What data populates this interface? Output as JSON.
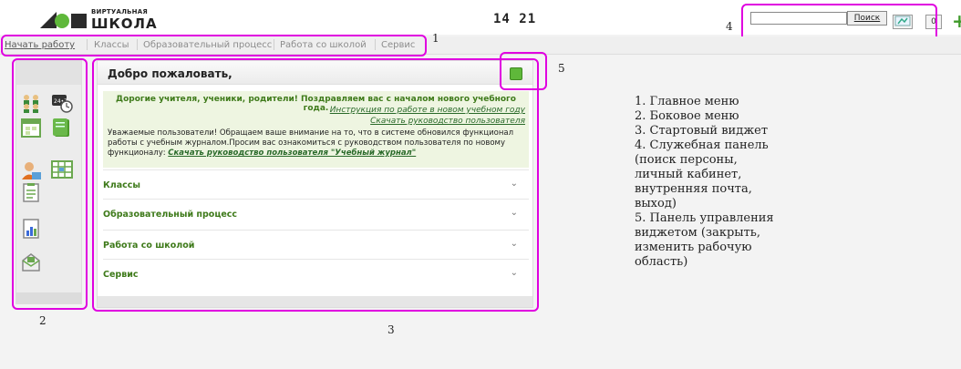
{
  "header": {
    "logo_small": "ВИРТУАЛЬНАЯ",
    "logo_big": "ШКОЛА",
    "time": "14 21",
    "search_button": "Поиск",
    "mail_count": "0"
  },
  "menu": {
    "items": [
      "Начать работу",
      "Классы",
      "Образовательный процесс",
      "Работа со школой",
      "Сервис"
    ]
  },
  "widget": {
    "title": "Добро пожаловать,",
    "greeting": "Дорогие учителя, ученики, родители! Поздравляем вас с началом нового учебного года.",
    "link_instruction": "Инструкция по работе в новом учебном году",
    "link_guide": "Скачать руководство пользователя",
    "notice": "Уважаемые пользователи! Обращаем ваше внимание на то, что в системе обновился функционал работы с учебным журналом.Просим вас ознакомиться с руководством пользователя по новому функционалу:",
    "notice_link": "Скачать руководство пользователя \"Учебный журнал\"",
    "sections": [
      "Классы",
      "Образовательный процесс",
      "Работа со школой",
      "Сервис"
    ]
  },
  "annotations": {
    "n1": "1",
    "n2": "2",
    "n3": "3",
    "n4": "4",
    "n5": "5"
  },
  "legend": [
    "1. Главное меню",
    "2. Боковое меню",
    "3. Стартовый виджет",
    "4. Служебная панель",
    "(поиск персоны,",
    "личный кабинет,",
    "внутренняя почта,",
    "выход)",
    "5. Панель управления",
    "виджетом (закрыть,",
    "изменить рабочую",
    "область)"
  ],
  "colors": {
    "accent_green": "#5fb83a",
    "annotation_magenta": "#e000e0",
    "link_green": "#3e7a1a"
  }
}
